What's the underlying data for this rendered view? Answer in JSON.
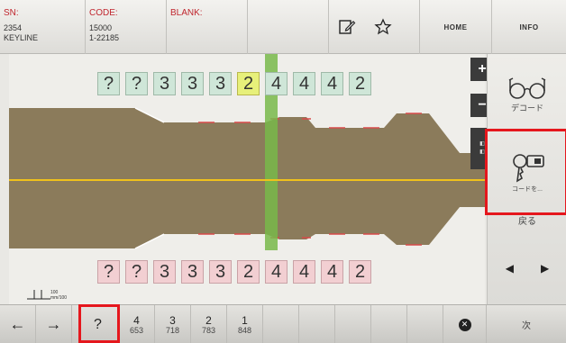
{
  "header": {
    "sn_label": "SN:",
    "sn_value_1": "2354",
    "sn_value_2": "KEYLINE",
    "code_label": "CODE:",
    "code_value_1": "15000",
    "code_value_2": "1-22185",
    "blank_label": "BLANK:",
    "home_label": "HOME",
    "info_label": "INFO"
  },
  "cuts_top": [
    "?",
    "?",
    "3",
    "3",
    "3",
    "2",
    "4",
    "4",
    "4",
    "2"
  ],
  "cuts_bottom": [
    "?",
    "?",
    "3",
    "3",
    "3",
    "2",
    "4",
    "4",
    "4",
    "2"
  ],
  "selected_index": 5,
  "zoom": {
    "plus": "+",
    "minus": "−"
  },
  "side": {
    "decode_label": "デコード",
    "code_label": "コードを...",
    "back_label": "戻る",
    "next_label": "次"
  },
  "scale_label": "100 mm/100",
  "bottom": {
    "question": "?",
    "items": [
      {
        "num": "4",
        "sub": "653"
      },
      {
        "num": "3",
        "sub": "718"
      },
      {
        "num": "2",
        "sub": "783"
      },
      {
        "num": "1",
        "sub": "848"
      }
    ]
  },
  "colors": {
    "key_body": "#8b7b5b",
    "center_line": "#f0c11b",
    "selected_column": "#78b84a",
    "highlight": "#e5171d"
  }
}
